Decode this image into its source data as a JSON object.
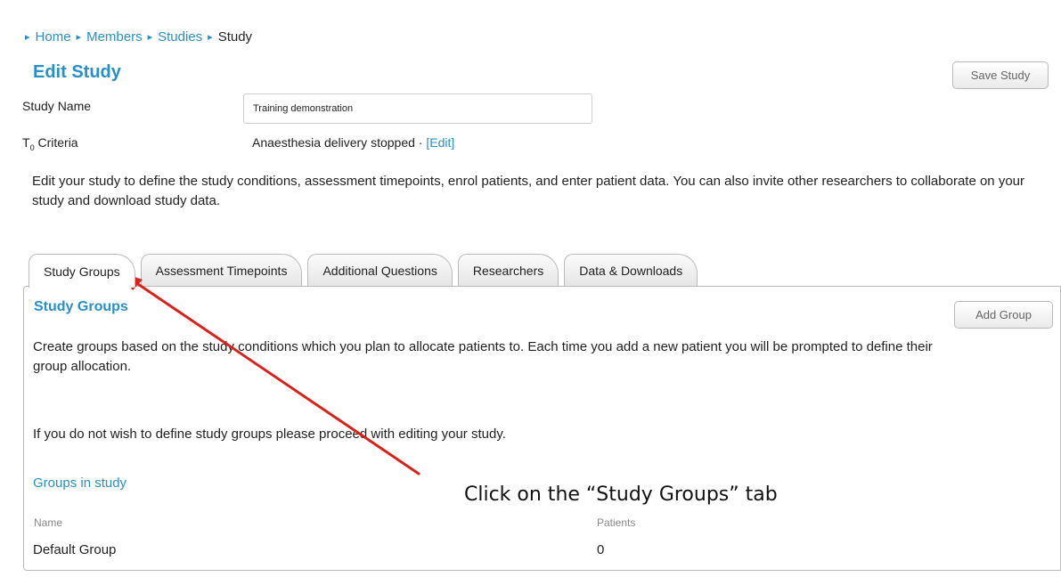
{
  "breadcrumb": {
    "items": [
      {
        "label": "Home",
        "current": false
      },
      {
        "label": "Members",
        "current": false
      },
      {
        "label": "Studies",
        "current": false
      },
      {
        "label": "Study",
        "current": true
      }
    ],
    "separator": "›"
  },
  "page": {
    "title": "Edit Study",
    "save_label": "Save Study"
  },
  "form": {
    "study_name_label": "Study Name",
    "study_name_value": "Training demonstration",
    "t0_label": "T",
    "t0_sub": "0",
    "t0_rest": " Criteria",
    "criteria_value": "Anaesthesia delivery stopped · ",
    "criteria_edit": "[Edit]"
  },
  "description": "Edit your study to define the study conditions, assessment timepoints, enrol patients, and enter patient data. You can also invite other researchers to collaborate on your study and download study data.",
  "tabs": [
    {
      "label": "Study Groups",
      "active": true
    },
    {
      "label": "Assessment Timepoints",
      "active": false
    },
    {
      "label": "Additional Questions",
      "active": false
    },
    {
      "label": "Researchers",
      "active": false
    },
    {
      "label": "Data & Downloads",
      "active": false
    }
  ],
  "panel": {
    "title": "Study Groups",
    "add_label": "Add Group",
    "intro": "Create groups based on the study conditions which you plan to allocate patients to. Each time you add a new patient you will be prompted to define their group allocation.",
    "note": "If you do not wish to define study groups please proceed with editing your study.",
    "groups_heading": "Groups in study",
    "columns": [
      "Name",
      "Patients"
    ],
    "rows": [
      {
        "name": "Default Group",
        "patients": "0"
      }
    ]
  },
  "annotation": {
    "text": "Click on the “Study Groups” tab",
    "arrow_color": "#d9221c"
  },
  "colors": {
    "accent": "#2a8fc9"
  }
}
